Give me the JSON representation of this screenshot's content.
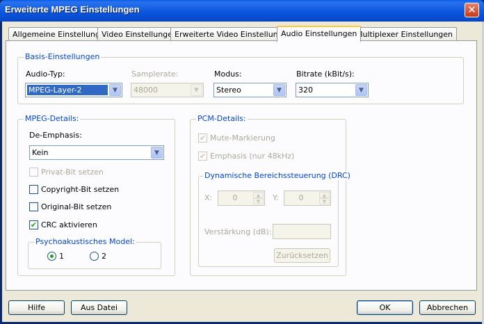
{
  "window": {
    "title": "Erweiterte MPEG Einstellungen",
    "close_glyph": "✕"
  },
  "tabs": [
    {
      "label": "Allgemeine Einstellungen"
    },
    {
      "label": "Video Einstellungen"
    },
    {
      "label": "Erweiterte Video Einstellungen"
    },
    {
      "label": "Audio Einstellungen",
      "active": true
    },
    {
      "label": "Multiplexer Einstellungen"
    }
  ],
  "basis": {
    "legend": "Basis-Einstellungen",
    "audio_typ": {
      "label": "Audio-Typ:",
      "value": "MPEG-Layer-2"
    },
    "samplerate": {
      "label": "Samplerate:",
      "value": "48000",
      "enabled": false
    },
    "modus": {
      "label": "Modus:",
      "value": "Stereo"
    },
    "bitrate": {
      "label": "Bitrate (kBit/s):",
      "value": "320"
    }
  },
  "mpeg_details": {
    "legend": "MPEG-Details:",
    "de_emphasis": {
      "label": "De-Emphasis:",
      "value": "Kein"
    },
    "privat_bit": {
      "label": "Privat-Bit setzen",
      "checked": false,
      "enabled": false
    },
    "copyright_bit": {
      "label": "Copyright-Bit setzen",
      "checked": false
    },
    "original_bit": {
      "label": "Original-Bit setzen",
      "checked": false
    },
    "crc": {
      "label": "CRC aktivieren",
      "checked": true
    },
    "psycho": {
      "legend": "Psychoakustisches Model:",
      "options": [
        {
          "label": "1",
          "selected": true
        },
        {
          "label": "2",
          "selected": false
        }
      ]
    }
  },
  "pcm_details": {
    "legend": "PCM-Details:",
    "mute": {
      "label": "Mute-Markierung",
      "checked": true,
      "enabled": false
    },
    "emphasis": {
      "label": "Emphasis (nur 48kHz)",
      "checked": true,
      "enabled": false
    },
    "drc": {
      "legend": "Dynamische Bereichssteuerung (DRC)",
      "x": {
        "label": "X:",
        "value": "0"
      },
      "y": {
        "label": "Y:",
        "value": "0"
      },
      "verstaerkung": {
        "label": "Verstärkung (dB):",
        "value": ""
      },
      "reset_label": "Zurücksetzen"
    }
  },
  "buttons": {
    "hilfe": "Hilfe",
    "aus_datei": "Aus Datei",
    "ok": "OK",
    "abbrechen": "Abbrechen"
  },
  "icons": {
    "check": "✔",
    "dropdown_arrow": "▼",
    "spin_up": "▲",
    "spin_down": "▼"
  },
  "colors": {
    "title_bar": "#0a57de",
    "group_legend": "#0046d5",
    "selection": "#316ac5",
    "dialog_bg": "#ece9d8"
  }
}
